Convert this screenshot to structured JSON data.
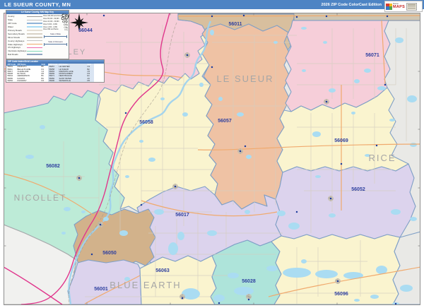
{
  "header": {
    "title": "LE SUEUR COUNTY, MN",
    "edition": "2026 ZIP Code ColorCast Edition",
    "logo_top": "Market",
    "logo_brand": "MAPS"
  },
  "legend": {
    "title": "Le Sueur County, MN Map Key",
    "line_items": [
      {
        "label": "County",
        "color": "#9a9a9a"
      },
      {
        "label": "State",
        "color": "#bfbfbf"
      },
      {
        "label": "ZIP Code",
        "color": "#8fb3d9"
      },
      {
        "label": "Water",
        "color": "#a9dcf5"
      },
      {
        "label": "Primary Roads",
        "color": "#e3ddd2"
      },
      {
        "label": "Secondary Roads",
        "color": "#d8d2c6"
      },
      {
        "label": "Minor Roads",
        "color": "#cfc8bb"
      },
      {
        "label": "County Highways",
        "color": "#c4c4c4"
      },
      {
        "label": "State Highways",
        "color": "#f0aa6e"
      },
      {
        "label": "US Highways",
        "color": "#ef6eae"
      },
      {
        "label": "Interstate Highways",
        "color": "#7fd9b8"
      },
      {
        "label": "Rail Roads",
        "color": "#93a7c4"
      }
    ],
    "city_classes": [
      {
        "label": "Cities 100,000 and Above",
        "sample": "City"
      },
      {
        "label": "Cities 50,000 - 99,999",
        "sample": "City"
      },
      {
        "label": "Cities 10,000 - 49,999",
        "sample": "City"
      },
      {
        "label": "Cities 5,000 - 9,999",
        "sample": "City"
      },
      {
        "label": "Cities 1,000 - 4,999",
        "sample": "City"
      },
      {
        "label": "Cities 999 and Below",
        "sample": "City"
      }
    ],
    "scale_miles": "Scale in Miles",
    "scale_km": "Scale in Kilometers"
  },
  "index_table": {
    "title": "ZIP Code Index/Grid Locator",
    "columns": [
      "ZIP Code",
      "ZIP Name",
      "Grid",
      "ZIP Code",
      "ZIP Name",
      "Grid"
    ],
    "rows": [
      [
        "56001",
        "MANKATO",
        "B5",
        "56057",
        "LE CENTER",
        "C3"
      ],
      [
        "56011",
        "BELLE PLAINE",
        "D1",
        "56058",
        "LE SUEUR",
        "B2"
      ],
      [
        "56017",
        "CLEVELAND",
        "C4",
        "56063",
        "MADISON LAKE",
        "C5"
      ],
      [
        "56028",
        "ELYSIAN",
        "D5",
        "56069",
        "MONTGOMERY",
        "D3"
      ],
      [
        "56044",
        "HENDERSON",
        "B1",
        "56071",
        "NEW PRAGUE",
        "E1"
      ],
      [
        "56050",
        "KASOTA",
        "B4",
        "56082",
        "SAINT PETER",
        "A3"
      ],
      [
        "56052",
        "KILKENNY",
        "D4",
        "56096",
        "WATERVILLE",
        "D5"
      ]
    ]
  },
  "map": {
    "zip_labels": [
      "56044",
      "56011",
      "56071",
      "56058",
      "56057",
      "56069",
      "56052",
      "56082",
      "56017",
      "56050",
      "56063",
      "56001",
      "56028",
      "56096"
    ],
    "county_labels": [
      "LE SUEUR",
      "RICE",
      "NICOLLET",
      "BLUE EARTH",
      "SIBLEY"
    ]
  },
  "colors": {
    "header_bg": "#4d84c4",
    "zip_label": "#2e3f9f",
    "county_label": "#a6a6a6",
    "water": "#aadcf2",
    "us_highway": "#e0368c",
    "state_highway": "#f0aa6e",
    "zip_boundary": "#7f9fc6"
  }
}
